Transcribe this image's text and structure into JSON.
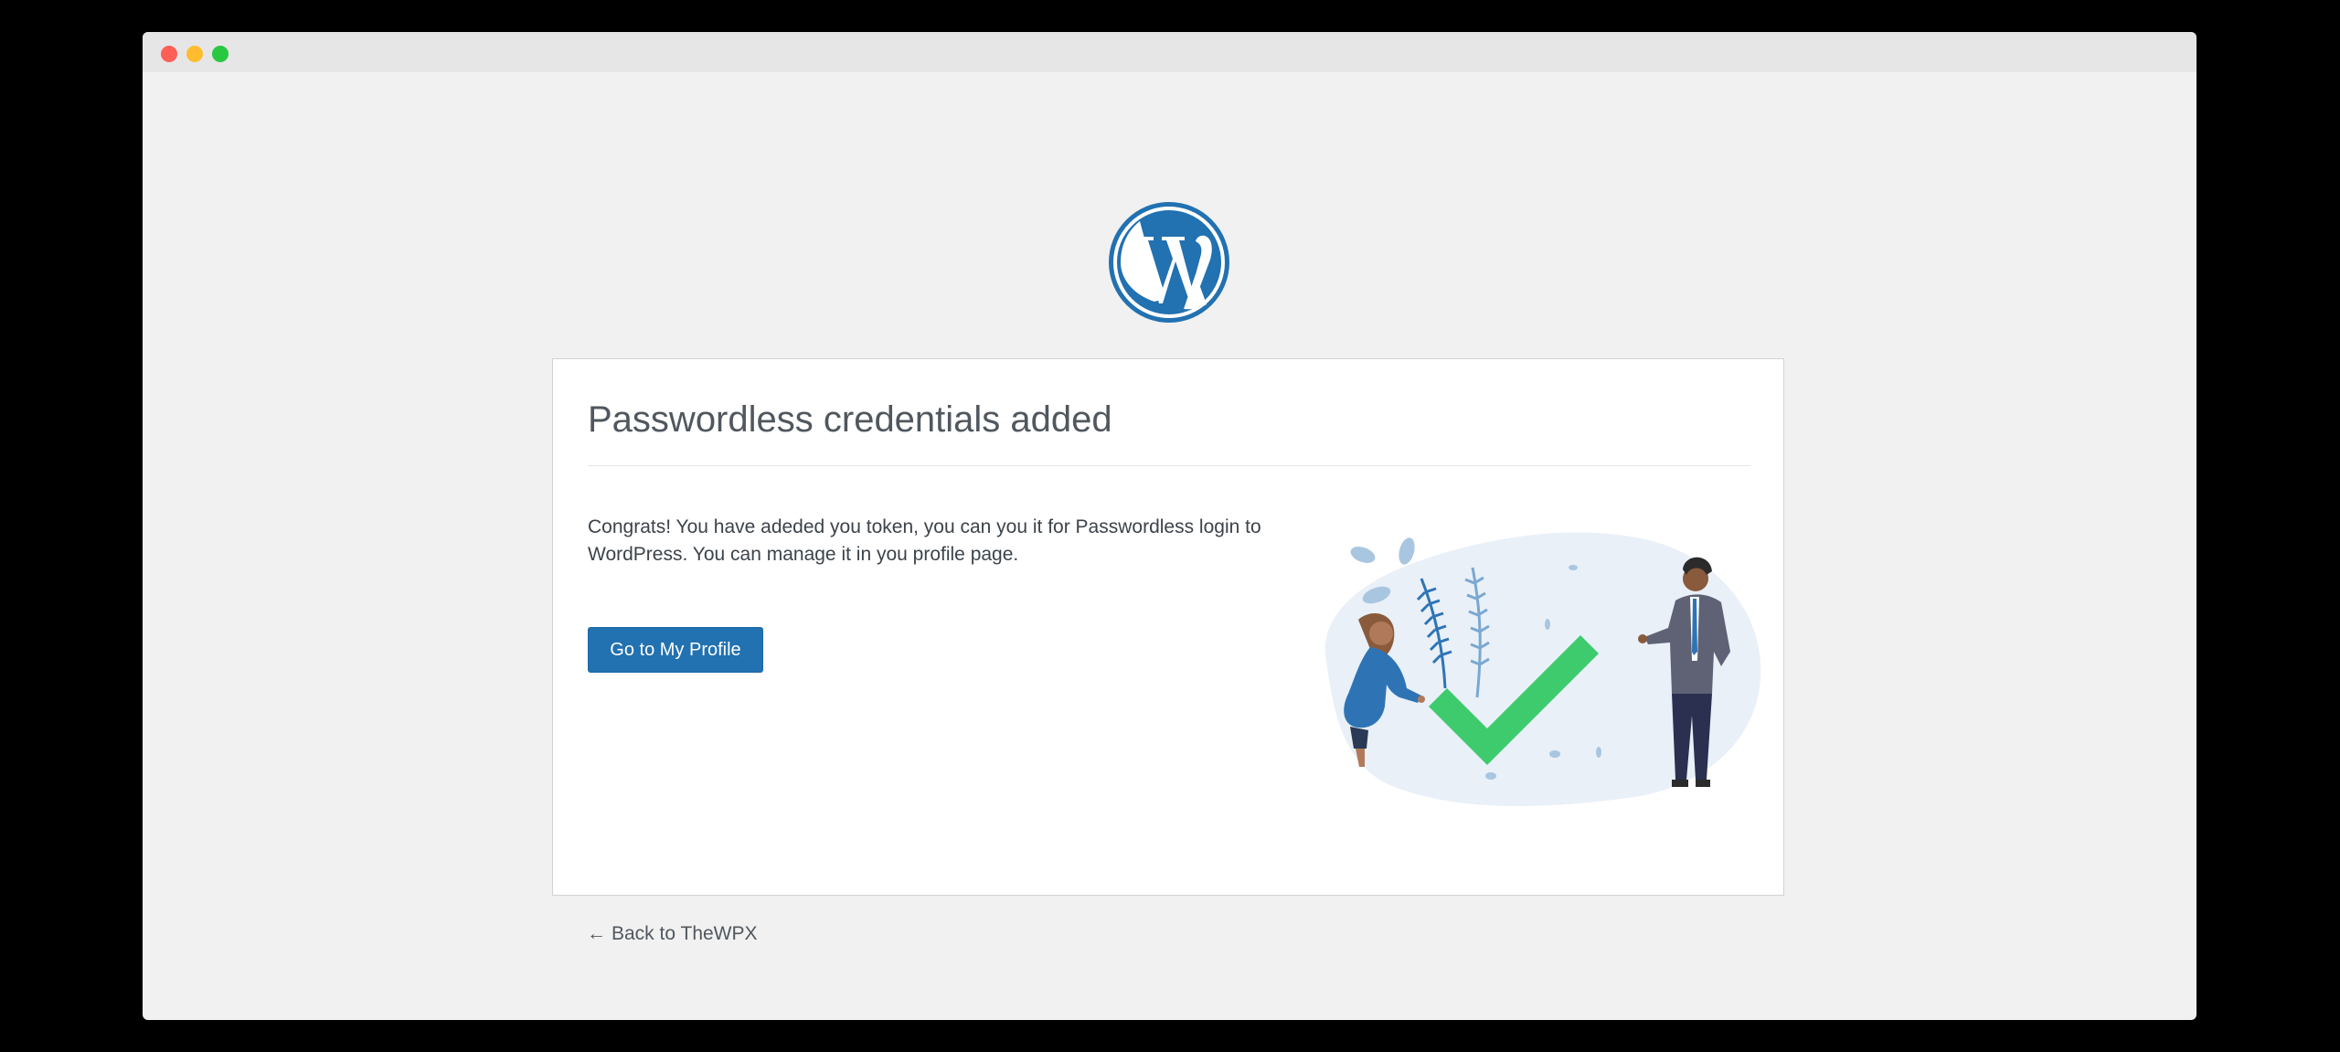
{
  "window": {
    "controls": [
      "close",
      "minimize",
      "maximize"
    ]
  },
  "logo": {
    "icon": "wordpress-logo-icon",
    "color": "#2271b1"
  },
  "card": {
    "title": "Passwordless credentials added",
    "message": "Congrats! You have adeded you token, you can you it for Passwordless login to WordPress. You can manage it in you profile page.",
    "primary_button_label": "Go to My Profile",
    "illustration": "success-checkmark-illustration"
  },
  "footer": {
    "back_arrow": "←",
    "back_link_label": "Back to TheWPX"
  },
  "colors": {
    "accent": "#2271b1",
    "background": "#f1f1f1",
    "card": "#ffffff",
    "check": "#3ecb6e"
  }
}
